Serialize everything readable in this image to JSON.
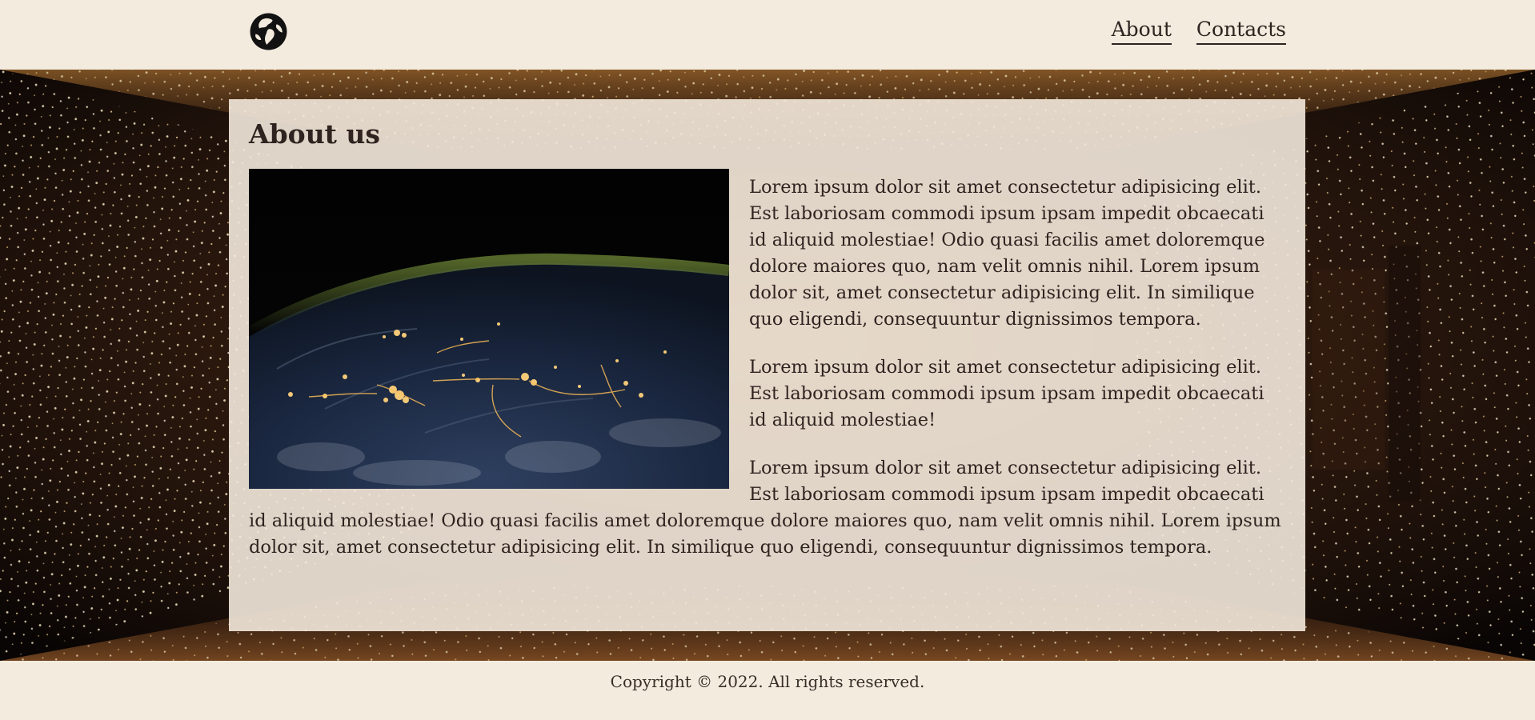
{
  "header": {
    "logo_icon": "globe-icon",
    "nav": [
      {
        "label": "About"
      },
      {
        "label": "Contacts"
      }
    ]
  },
  "main": {
    "title": "About us",
    "image_icon": "earth-at-night-photo",
    "paragraphs": [
      "Lorem ipsum dolor sit amet consectetur adipisicing elit. Est laboriosam commodi ipsum ipsam impedit obcaecati id aliquid molestiae! Odio quasi facilis amet doloremque dolore maiores quo, nam velit omnis nihil. Lorem ipsum dolor sit, amet consectetur adipisicing elit. In similique quo eligendi, consequuntur dignissimos tempora.",
      "Lorem ipsum dolor sit amet consectetur adipisicing elit. Est laboriosam commodi ipsum ipsam impedit obcaecati id aliquid molestiae!",
      "Lorem ipsum dolor sit amet consectetur adipisicing elit. Est laboriosam commodi ipsum ipsam impedit obcaecati id aliquid molestiae! Odio quasi facilis amet doloremque dolore maiores quo, nam velit omnis nihil. Lorem ipsum dolor sit, amet consectetur adipisicing elit. In similique quo eligendi, consequuntur dignissimos tempora."
    ]
  },
  "footer": {
    "copyright": "Copyright © 2022. All rights reserved."
  },
  "colors": {
    "background": "#f3ebdd",
    "text": "#2f2320",
    "card": "#f3e9db"
  }
}
